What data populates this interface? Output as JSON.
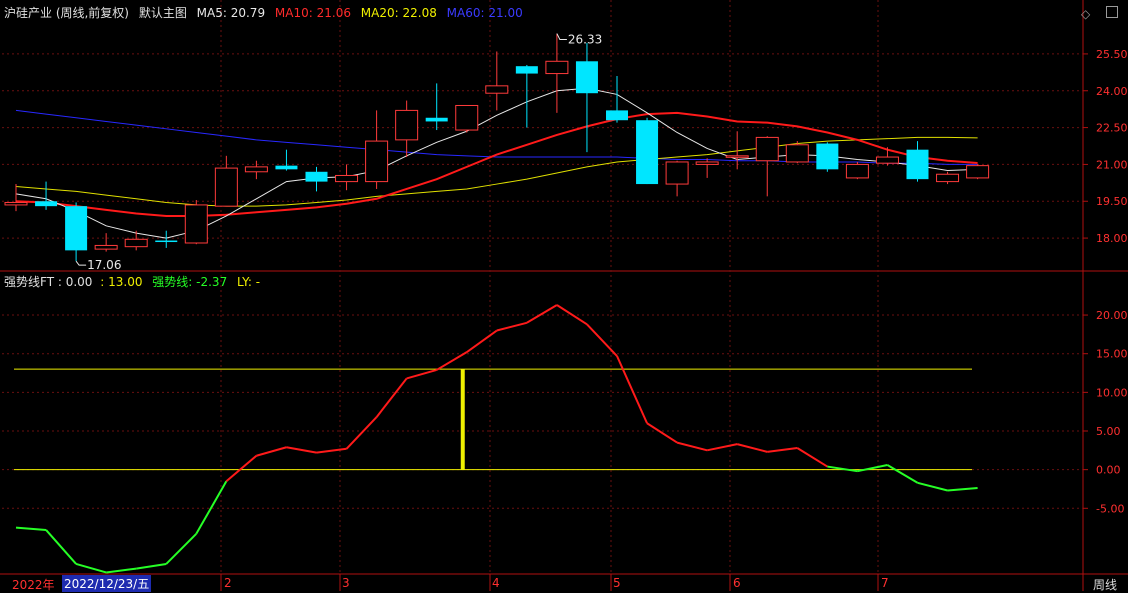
{
  "main_header": {
    "title": "沪硅产业 (周线,前复权)",
    "chart_selector": "默认主图",
    "indicators": [
      {
        "label": "MA5: 20.79",
        "color": "#e8e8e8"
      },
      {
        "label": "MA10: 21.06",
        "color": "#ff2b2b"
      },
      {
        "label": "MA20: 22.08",
        "color": "#f0f000"
      },
      {
        "label": "MA60: 21.00",
        "color": "#3b3bff"
      }
    ]
  },
  "indicator_header": {
    "name": "强势线FT : 0.00",
    "value2": ": 13.00",
    "value3": "强势线: -2.37",
    "value4": "LY: -"
  },
  "icons": [
    "diamond-icon",
    "window-icon"
  ],
  "date_bar": {
    "year": "2022年",
    "cursor_date": "2022/12/23/五",
    "months": [
      "2",
      "3",
      "4",
      "5",
      "6",
      "7"
    ],
    "period": "周线"
  },
  "chart_data": [
    {
      "type": "candlestick",
      "ylim": [
        16.7,
        26.8
      ],
      "yticks": [
        "25.50",
        "24.00",
        "22.50",
        "21.00",
        "19.50",
        "18.00"
      ],
      "annotations": [
        {
          "text": "26.33",
          "at": "high"
        },
        {
          "text": "17.06",
          "at": "low"
        }
      ],
      "colors": {
        "up": "#ff3b3b",
        "down": "#00e6ff",
        "bg": "#000000"
      },
      "candles": [
        {
          "o": 19.35,
          "h": 20.2,
          "l": 19.1,
          "c": 19.45
        },
        {
          "o": 19.5,
          "h": 20.3,
          "l": 19.15,
          "c": 19.3
        },
        {
          "o": 19.3,
          "h": 19.45,
          "l": 17.06,
          "c": 17.5
        },
        {
          "o": 17.55,
          "h": 18.2,
          "l": 17.45,
          "c": 17.7
        },
        {
          "o": 17.65,
          "h": 18.3,
          "l": 17.5,
          "c": 17.95
        },
        {
          "o": 17.9,
          "h": 18.3,
          "l": 17.6,
          "c": 17.85
        },
        {
          "o": 17.8,
          "h": 19.55,
          "l": 17.75,
          "c": 19.35
        },
        {
          "o": 19.3,
          "h": 21.35,
          "l": 19.3,
          "c": 20.85
        },
        {
          "o": 20.7,
          "h": 21.15,
          "l": 20.4,
          "c": 20.9
        },
        {
          "o": 20.95,
          "h": 21.6,
          "l": 20.75,
          "c": 20.8
        },
        {
          "o": 20.7,
          "h": 20.9,
          "l": 19.9,
          "c": 20.3
        },
        {
          "o": 20.3,
          "h": 21.0,
          "l": 19.95,
          "c": 20.55
        },
        {
          "o": 20.3,
          "h": 23.2,
          "l": 20.0,
          "c": 21.95
        },
        {
          "o": 22.0,
          "h": 23.6,
          "l": 21.3,
          "c": 23.2
        },
        {
          "o": 22.9,
          "h": 24.3,
          "l": 22.4,
          "c": 22.75
        },
        {
          "o": 22.4,
          "h": 23.3,
          "l": 22.3,
          "c": 23.4
        },
        {
          "o": 23.9,
          "h": 25.6,
          "l": 23.2,
          "c": 24.2
        },
        {
          "o": 25.0,
          "h": 25.05,
          "l": 22.5,
          "c": 24.7
        },
        {
          "o": 24.7,
          "h": 26.33,
          "l": 23.1,
          "c": 25.2
        },
        {
          "o": 25.2,
          "h": 25.95,
          "l": 21.5,
          "c": 23.9
        },
        {
          "o": 23.2,
          "h": 24.6,
          "l": 22.7,
          "c": 22.8
        },
        {
          "o": 22.8,
          "h": 22.9,
          "l": 20.2,
          "c": 20.2
        },
        {
          "o": 20.2,
          "h": 21.15,
          "l": 19.7,
          "c": 21.1
        },
        {
          "o": 21.0,
          "h": 21.25,
          "l": 20.45,
          "c": 21.1
        },
        {
          "o": 21.3,
          "h": 22.35,
          "l": 20.8,
          "c": 21.35
        },
        {
          "o": 21.15,
          "h": 22.15,
          "l": 19.7,
          "c": 22.1
        },
        {
          "o": 21.1,
          "h": 21.95,
          "l": 21.05,
          "c": 21.8
        },
        {
          "o": 21.85,
          "h": 21.9,
          "l": 20.7,
          "c": 20.8
        },
        {
          "o": 20.45,
          "h": 21.1,
          "l": 20.4,
          "c": 21.0
        },
        {
          "o": 21.05,
          "h": 21.7,
          "l": 20.95,
          "c": 21.3
        },
        {
          "o": 21.6,
          "h": 21.95,
          "l": 20.3,
          "c": 20.4
        },
        {
          "o": 20.3,
          "h": 20.7,
          "l": 20.2,
          "c": 20.6
        },
        {
          "o": 20.45,
          "h": 21.0,
          "l": 20.4,
          "c": 20.95
        }
      ],
      "ma5": [
        19.8,
        19.6,
        19.1,
        18.5,
        18.2,
        18.0,
        18.3,
        18.9,
        19.6,
        20.3,
        20.45,
        20.5,
        20.75,
        21.35,
        21.9,
        22.35,
        23.0,
        23.55,
        24.0,
        24.1,
        23.85,
        23.1,
        22.3,
        21.65,
        21.2,
        21.3,
        21.4,
        21.35,
        21.2,
        21.1,
        20.95,
        20.75,
        20.8
      ],
      "ma10": [
        19.5,
        19.45,
        19.3,
        19.15,
        19.0,
        18.9,
        18.9,
        18.95,
        19.05,
        19.15,
        19.25,
        19.4,
        19.6,
        20.0,
        20.4,
        20.9,
        21.4,
        21.8,
        22.2,
        22.55,
        22.85,
        23.05,
        23.1,
        22.95,
        22.75,
        22.7,
        22.55,
        22.3,
        22.0,
        21.6,
        21.3,
        21.15,
        21.06
      ],
      "ma20": [
        20.1,
        20.0,
        19.9,
        19.75,
        19.6,
        19.45,
        19.35,
        19.3,
        19.3,
        19.35,
        19.45,
        19.55,
        19.7,
        19.8,
        19.9,
        20.0,
        20.2,
        20.4,
        20.65,
        20.9,
        21.1,
        21.2,
        21.3,
        21.4,
        21.55,
        21.7,
        21.85,
        21.95,
        22.0,
        22.05,
        22.1,
        22.1,
        22.08
      ],
      "ma60": [
        23.2,
        23.05,
        22.9,
        22.75,
        22.6,
        22.45,
        22.3,
        22.15,
        22.0,
        21.9,
        21.8,
        21.7,
        21.6,
        21.5,
        21.4,
        21.35,
        21.3,
        21.3,
        21.3,
        21.3,
        21.3,
        21.25,
        21.2,
        21.2,
        21.15,
        21.15,
        21.1,
        21.1,
        21.1,
        21.05,
        21.05,
        21.0,
        21.0
      ]
    },
    {
      "type": "line",
      "name": "强势线",
      "ylim": [
        -13.5,
        23.5
      ],
      "yticks": [
        "20.00",
        "15.00",
        "10.00",
        "5.00",
        "0.00",
        "-5.00"
      ],
      "reference_lines": [
        0.0,
        13.0
      ],
      "values": [
        -7.5,
        -7.8,
        -12.2,
        -13.3,
        -12.8,
        -12.2,
        -8.3,
        -1.5,
        1.8,
        2.9,
        2.2,
        2.7,
        6.8,
        11.8,
        12.9,
        15.2,
        18.0,
        19.0,
        21.3,
        18.8,
        14.7,
        6.0,
        3.5,
        2.5,
        3.3,
        2.3,
        2.8,
        0.4,
        -0.2,
        0.6,
        -1.7,
        -2.7,
        -2.37
      ],
      "highlight_index": 15,
      "colors": {
        "up": "#ff1a1a",
        "down": "#26ff26",
        "ref": "#f0f000"
      }
    }
  ]
}
